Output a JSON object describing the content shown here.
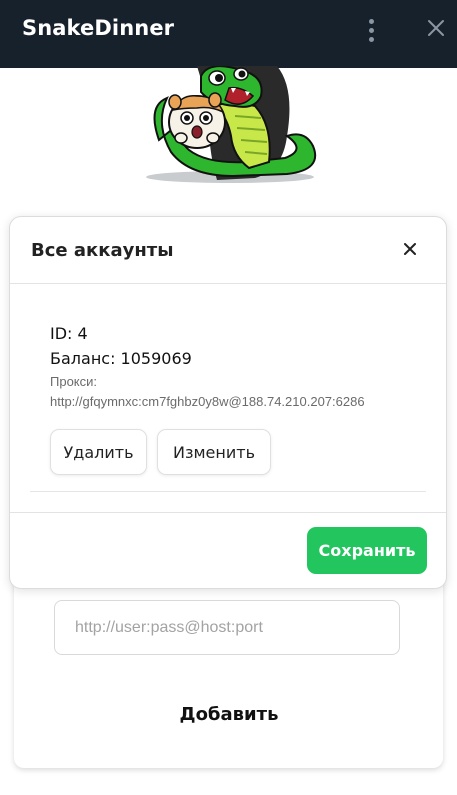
{
  "app": {
    "title": "SnakeDinner"
  },
  "icons": {
    "menu": "vertical-dots-icon",
    "close": "close-icon",
    "mascot": "snake-hamster-mascot"
  },
  "colors": {
    "header_bg": "#17212b",
    "accent_green": "#22c55e",
    "snake_green": "#2fb62f"
  },
  "modal": {
    "title": "Все аккаунты",
    "account": {
      "id_line": "ID: 4",
      "balance_line": "Баланс: 1059069",
      "proxy_label": "Прокси:",
      "proxy_value": "http://gfqymnxc:cm7fghbz0y8w@188.74.210.207:6286"
    },
    "delete_label": "Удалить",
    "edit_label": "Изменить",
    "save_label": "Сохранить"
  },
  "form": {
    "proxy_placeholder": "http://user:pass@host:port",
    "add_label": "Добавить"
  }
}
